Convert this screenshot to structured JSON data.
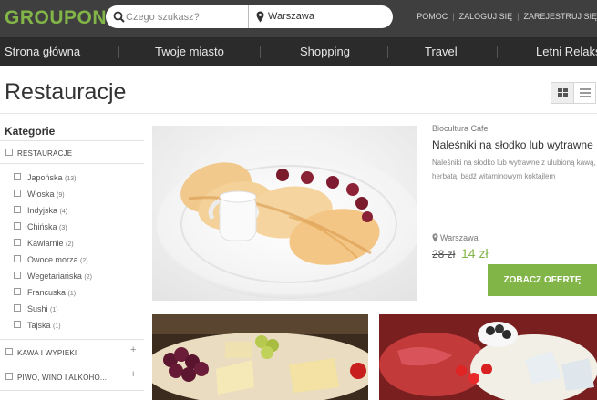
{
  "header": {
    "logo": "GROUPON",
    "search_placeholder": "Czego szukasz?",
    "city": "Warszawa",
    "links": [
      "POMOC",
      "ZALOGUJ SIĘ",
      "ZAREJESTRUJ SIĘ"
    ]
  },
  "nav": {
    "items": [
      "Strona główna",
      "Twoje miasto",
      "Shopping",
      "Travel",
      "Letni Relaks"
    ]
  },
  "page": {
    "title": "Restauracje"
  },
  "sidebar": {
    "title": "Kategorie",
    "main_category": "RESTAURACJE",
    "subcategories": [
      {
        "label": "Japońska",
        "count": "(13)"
      },
      {
        "label": "Włoska",
        "count": "(9)"
      },
      {
        "label": "Indyjska",
        "count": "(4)"
      },
      {
        "label": "Chińska",
        "count": "(3)"
      },
      {
        "label": "Kawiarnie",
        "count": "(2)"
      },
      {
        "label": "Owoce morza",
        "count": "(2)"
      },
      {
        "label": "Wegetariańska",
        "count": "(2)"
      },
      {
        "label": "Francuska",
        "count": "(1)"
      },
      {
        "label": "Sushi",
        "count": "(1)"
      },
      {
        "label": "Tajska",
        "count": "(1)"
      }
    ],
    "other_categories": [
      "KAWA I WYPIEKI",
      "PIWO, WINO I ALKOHO..."
    ]
  },
  "deal": {
    "merchant": "Biocultura Cafe",
    "title": "Naleśniki na słodko lub wytrawne",
    "description": "Naleśniki na słodko lub wytrawne z ulubioną kawą, herbatą, bądź witaminowym koktajlem",
    "location": "Warszawa",
    "old_price": "28 zł",
    "new_price": "14 zł",
    "cta": "ZOBACZ OFERTĘ"
  },
  "colors": {
    "brand_green": "#82b548",
    "topbar": "#3f3f3f",
    "navbar": "#2b2b2b"
  },
  "icons": [
    "search-icon",
    "location-pin-icon",
    "grid-view-icon",
    "list-view-icon",
    "minus-icon",
    "plus-icon"
  ]
}
